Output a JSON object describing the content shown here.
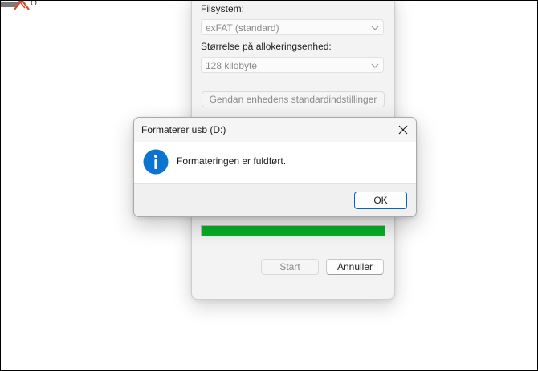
{
  "format_window": {
    "filesystem_label": "Filsystem:",
    "filesystem_value": "exFAT (standard)",
    "allocation_label": "Størrelse på allokeringsenhed:",
    "allocation_value": "128 kilobyte",
    "restore_defaults_label": "Gendan enhedens standardindstillinger",
    "progress_fraction": 1.0,
    "progress_color": "#06b025",
    "start_label": "Start",
    "cancel_label": "Annuller"
  },
  "dialog": {
    "title": "Formaterer usb (D:)",
    "message": "Formateringen er fuldført.",
    "ok_label": "OK",
    "icon": "info-icon",
    "icon_color": "#0a74d0"
  }
}
